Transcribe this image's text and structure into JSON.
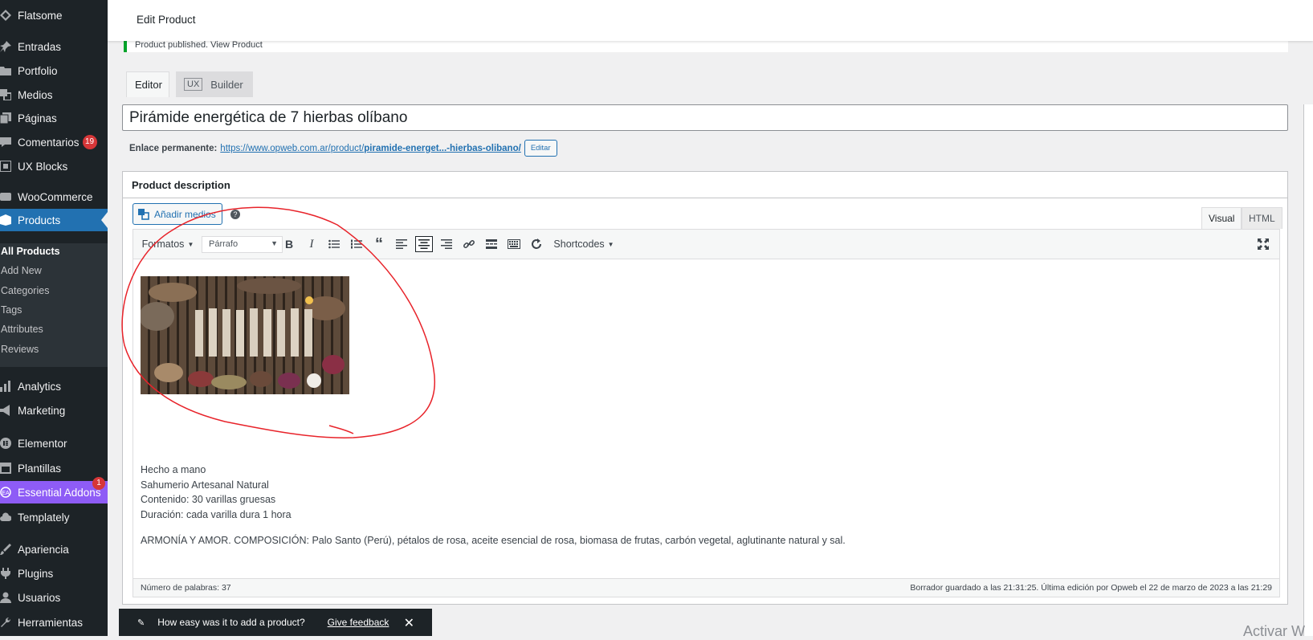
{
  "sidebar": {
    "items": [
      {
        "label": "Flatsome",
        "icon": "flatsome-icon"
      },
      {
        "label": "Entradas",
        "icon": "pin-icon"
      },
      {
        "label": "Portfolio",
        "icon": "folder-icon"
      },
      {
        "label": "Medios",
        "icon": "media-icon"
      },
      {
        "label": "Páginas",
        "icon": "pages-icon"
      },
      {
        "label": "Comentarios",
        "icon": "comments-icon",
        "badge": "19"
      },
      {
        "label": "UX Blocks",
        "icon": "blocks-icon"
      },
      {
        "label": "WooCommerce",
        "icon": "woo-icon"
      },
      {
        "label": "Products",
        "icon": "products-icon"
      },
      {
        "label": "Analytics",
        "icon": "analytics-icon"
      },
      {
        "label": "Marketing",
        "icon": "megaphone-icon"
      },
      {
        "label": "Elementor",
        "icon": "elementor-icon"
      },
      {
        "label": "Plantillas",
        "icon": "templates-icon"
      },
      {
        "label": "Essential Addons",
        "icon": "ea-icon",
        "badge": "1"
      },
      {
        "label": "Templately",
        "icon": "cloud-icon"
      },
      {
        "label": "Apariencia",
        "icon": "brush-icon"
      },
      {
        "label": "Plugins",
        "icon": "plug-icon"
      },
      {
        "label": "Usuarios",
        "icon": "user-icon"
      },
      {
        "label": "Herramientas",
        "icon": "wrench-icon"
      }
    ],
    "submenu": [
      "All Products",
      "Add New",
      "Categories",
      "Tags",
      "Attributes",
      "Reviews"
    ]
  },
  "header": {
    "title": "Edit Product"
  },
  "notice": {
    "text": "Product published. View Product"
  },
  "tabs": {
    "editor": "Editor",
    "ux": "UX",
    "builder": "Builder"
  },
  "product": {
    "title": "Pirámide energética de 7 hierbas olíbano",
    "permalink_label": "Enlace permanente:",
    "permalink_prefix": "https://www.opweb.com.ar/product/",
    "permalink_slug": "piramide-energet...-hierbas-olibano/",
    "edit_label": "Editar"
  },
  "description": {
    "box_title": "Product description",
    "add_media": "Añadir medios",
    "help": "?",
    "visual_tab": "Visual",
    "html_tab": "HTML",
    "toolbar": {
      "formats": "Formatos",
      "paragraph": "Párrafo",
      "shortcodes": "Shortcodes"
    },
    "lines": [
      "Hecho a mano",
      "Sahumerio Artesanal Natural",
      "Contenido: 30 varillas gruesas",
      "Duración: cada varilla dura 1 hora"
    ],
    "paragraph": "ARMONÍA Y AMOR. COMPOSICIÓN: Palo Santo (Perú), pétalos de rosa, aceite esencial de rosa, biomasa de frutas, carbón vegetal, aglutinante natural y sal.",
    "word_count": "Número de palabras: 37",
    "saved": "Borrador guardado a las 21:31:25. Última edición por Opweb el 22 de marzo de 2023 a las 21:29"
  },
  "toast": {
    "question": "How easy was it to add a product?",
    "feedback": "Give feedback",
    "close": "✕"
  },
  "watermark": "Activar W",
  "colors": {
    "accent": "#2271b1",
    "sidebar": "#1d2327",
    "essential_addons": "#8e5cf6",
    "annotation": "#e8232a"
  }
}
